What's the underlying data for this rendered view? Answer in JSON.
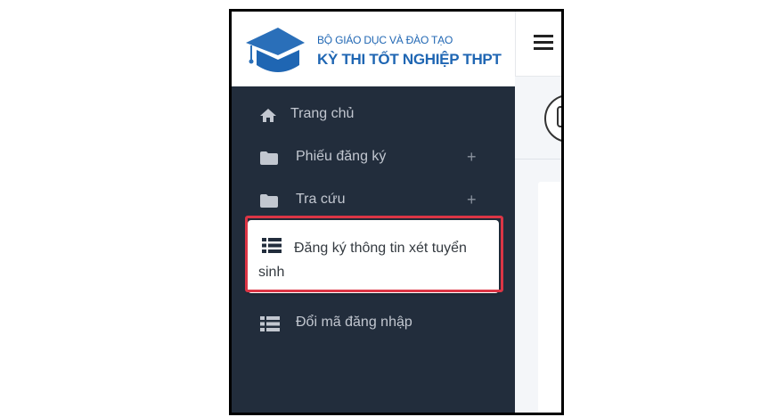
{
  "header": {
    "org_name": "BỘ GIÁO DỤC VÀ ĐÀO TẠO",
    "exam_title": "KỲ THI TỐT NGHIỆP THPT"
  },
  "icons": {
    "logo": "graduation-cap-icon",
    "menu": "hamburger-menu-icon",
    "home": "home-icon",
    "folder": "folder-icon",
    "list": "list-icon",
    "expand": "plus-icon"
  },
  "sidebar": {
    "items": [
      {
        "label": "Trang chủ",
        "icon": "home-icon",
        "expandable": false
      },
      {
        "label": "Phiếu đăng ký",
        "icon": "folder-icon",
        "expandable": true
      },
      {
        "label": "Tra cứu",
        "icon": "folder-icon",
        "expandable": true
      },
      {
        "label": "Đăng ký thông tin xét tuyển sinh",
        "icon": "list-icon",
        "expandable": false,
        "active": true
      },
      {
        "label": "Đổi mã đăng nhập",
        "icon": "list-icon",
        "expandable": false
      }
    ],
    "expand_symbol": "+"
  },
  "colors": {
    "sidebar_bg": "#222d3c",
    "brand_blue": "#1f66b3",
    "highlight_red": "#dc3545",
    "nav_text": "#c2c7d0"
  }
}
